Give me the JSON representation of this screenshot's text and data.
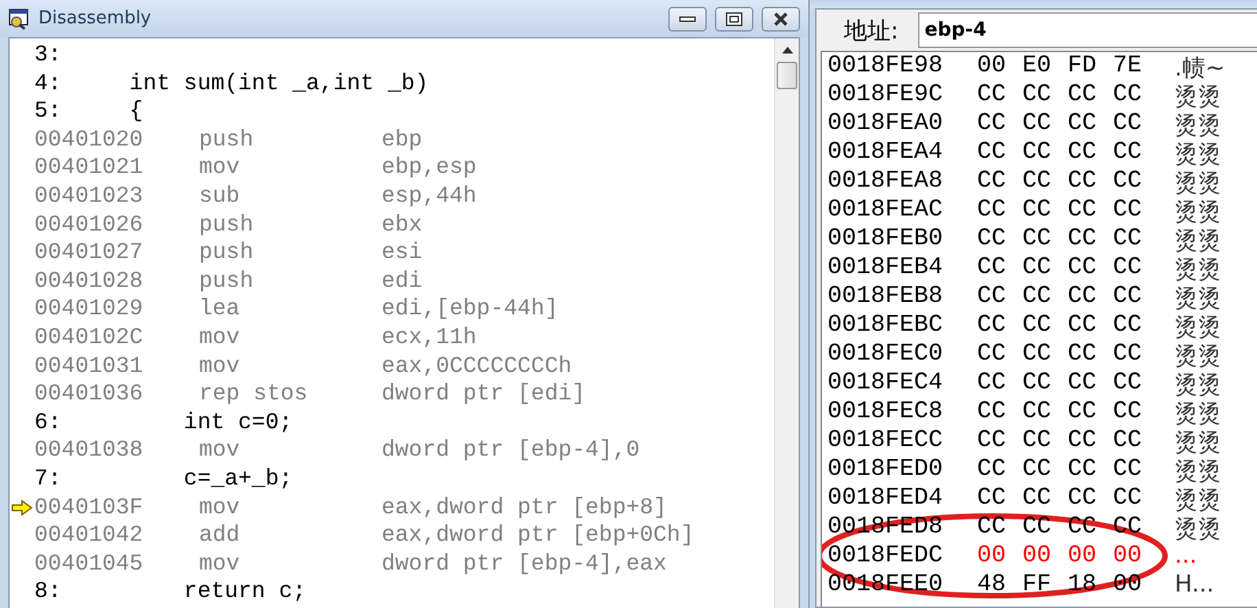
{
  "disassembly": {
    "title": "Disassembly",
    "lines": [
      {
        "kind": "source",
        "text": "3:"
      },
      {
        "kind": "source",
        "text": "4:     int sum(int _a,int _b)"
      },
      {
        "kind": "source",
        "text": "5:     {"
      },
      {
        "kind": "asm",
        "address": "00401020",
        "mnemonic": "push",
        "operands": "ebp",
        "current": false
      },
      {
        "kind": "asm",
        "address": "00401021",
        "mnemonic": "mov",
        "operands": "ebp,esp",
        "current": false
      },
      {
        "kind": "asm",
        "address": "00401023",
        "mnemonic": "sub",
        "operands": "esp,44h",
        "current": false
      },
      {
        "kind": "asm",
        "address": "00401026",
        "mnemonic": "push",
        "operands": "ebx",
        "current": false
      },
      {
        "kind": "asm",
        "address": "00401027",
        "mnemonic": "push",
        "operands": "esi",
        "current": false
      },
      {
        "kind": "asm",
        "address": "00401028",
        "mnemonic": "push",
        "operands": "edi",
        "current": false
      },
      {
        "kind": "asm",
        "address": "00401029",
        "mnemonic": "lea",
        "operands": "edi,[ebp-44h]",
        "current": false
      },
      {
        "kind": "asm",
        "address": "0040102C",
        "mnemonic": "mov",
        "operands": "ecx,11h",
        "current": false
      },
      {
        "kind": "asm",
        "address": "00401031",
        "mnemonic": "mov",
        "operands": "eax,0CCCCCCCCh",
        "current": false
      },
      {
        "kind": "asm",
        "address": "00401036",
        "mnemonic": "rep stos",
        "operands": "dword ptr [edi]",
        "current": false
      },
      {
        "kind": "source",
        "text": "6:         int c=0;"
      },
      {
        "kind": "asm",
        "address": "00401038",
        "mnemonic": "mov",
        "operands": "dword ptr [ebp-4],0",
        "current": false
      },
      {
        "kind": "source",
        "text": "7:         c=_a+_b;"
      },
      {
        "kind": "asm",
        "address": "0040103F",
        "mnemonic": "mov",
        "operands": "eax,dword ptr [ebp+8]",
        "current": true
      },
      {
        "kind": "asm",
        "address": "00401042",
        "mnemonic": "add",
        "operands": "eax,dword ptr [ebp+0Ch]",
        "current": false
      },
      {
        "kind": "asm",
        "address": "00401045",
        "mnemonic": "mov",
        "operands": "dword ptr [ebp-4],eax",
        "current": false
      },
      {
        "kind": "source",
        "text": "8:         return c;"
      }
    ]
  },
  "memory": {
    "address_label": "地址:",
    "address_value": "ebp-4",
    "rows": [
      {
        "address": "0018FE98",
        "bytes": [
          "00",
          "E0",
          "FD",
          "7E"
        ],
        "chars": ".帻~",
        "changed": false
      },
      {
        "address": "0018FE9C",
        "bytes": [
          "CC",
          "CC",
          "CC",
          "CC"
        ],
        "chars": "烫烫",
        "changed": false
      },
      {
        "address": "0018FEA0",
        "bytes": [
          "CC",
          "CC",
          "CC",
          "CC"
        ],
        "chars": "烫烫",
        "changed": false
      },
      {
        "address": "0018FEA4",
        "bytes": [
          "CC",
          "CC",
          "CC",
          "CC"
        ],
        "chars": "烫烫",
        "changed": false
      },
      {
        "address": "0018FEA8",
        "bytes": [
          "CC",
          "CC",
          "CC",
          "CC"
        ],
        "chars": "烫烫",
        "changed": false
      },
      {
        "address": "0018FEAC",
        "bytes": [
          "CC",
          "CC",
          "CC",
          "CC"
        ],
        "chars": "烫烫",
        "changed": false
      },
      {
        "address": "0018FEB0",
        "bytes": [
          "CC",
          "CC",
          "CC",
          "CC"
        ],
        "chars": "烫烫",
        "changed": false
      },
      {
        "address": "0018FEB4",
        "bytes": [
          "CC",
          "CC",
          "CC",
          "CC"
        ],
        "chars": "烫烫",
        "changed": false
      },
      {
        "address": "0018FEB8",
        "bytes": [
          "CC",
          "CC",
          "CC",
          "CC"
        ],
        "chars": "烫烫",
        "changed": false
      },
      {
        "address": "0018FEBC",
        "bytes": [
          "CC",
          "CC",
          "CC",
          "CC"
        ],
        "chars": "烫烫",
        "changed": false
      },
      {
        "address": "0018FEC0",
        "bytes": [
          "CC",
          "CC",
          "CC",
          "CC"
        ],
        "chars": "烫烫",
        "changed": false
      },
      {
        "address": "0018FEC4",
        "bytes": [
          "CC",
          "CC",
          "CC",
          "CC"
        ],
        "chars": "烫烫",
        "changed": false
      },
      {
        "address": "0018FEC8",
        "bytes": [
          "CC",
          "CC",
          "CC",
          "CC"
        ],
        "chars": "烫烫",
        "changed": false
      },
      {
        "address": "0018FECC",
        "bytes": [
          "CC",
          "CC",
          "CC",
          "CC"
        ],
        "chars": "烫烫",
        "changed": false
      },
      {
        "address": "0018FED0",
        "bytes": [
          "CC",
          "CC",
          "CC",
          "CC"
        ],
        "chars": "烫烫",
        "changed": false
      },
      {
        "address": "0018FED4",
        "bytes": [
          "CC",
          "CC",
          "CC",
          "CC"
        ],
        "chars": "烫烫",
        "changed": false
      },
      {
        "address": "0018FED8",
        "bytes": [
          "CC",
          "CC",
          "CC",
          "CC"
        ],
        "chars": "烫烫",
        "changed": false
      },
      {
        "address": "0018FEDC",
        "bytes": [
          "00",
          "00",
          "00",
          "00"
        ],
        "chars": "...",
        "changed": true
      },
      {
        "address": "0018FEE0",
        "bytes": [
          "48",
          "FF",
          "18",
          "00"
        ],
        "chars": "H...",
        "changed": false
      }
    ]
  }
}
